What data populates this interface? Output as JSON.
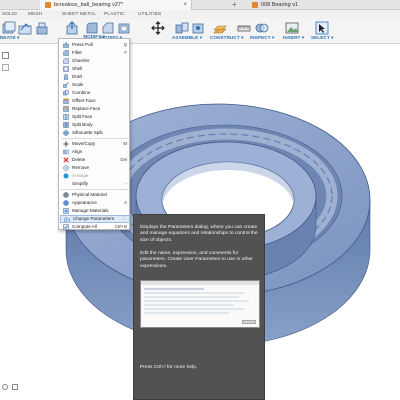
{
  "tabs": {
    "active": {
      "label": "bcrealess_ball_bearing v27*",
      "close": "×"
    },
    "add": "+",
    "second": {
      "label": "008 Bearing v1"
    }
  },
  "workspace_tabs": [
    "SOLID",
    "MESH",
    "SHEET METAL",
    "PLASTIC",
    "UTILITIES"
  ],
  "ribbon": {
    "groups": [
      "REATE ▾",
      "MODIFY ▾",
      "ASSEMBLE ▾",
      "CONSTRUCT ▾",
      "INSPECT ▾",
      "INSERT ▾",
      "SELECT ▾"
    ]
  },
  "modify_menu": {
    "header": "MODIFY ▾",
    "items": [
      {
        "label": "Press Pull",
        "shortcut": "Q",
        "icon": "press-pull-icon"
      },
      {
        "label": "Fillet",
        "shortcut": "F",
        "icon": "fillet-icon"
      },
      {
        "label": "Chamfer",
        "shortcut": "",
        "icon": "chamfer-icon"
      },
      {
        "label": "Shell",
        "shortcut": "",
        "icon": "shell-icon"
      },
      {
        "label": "Draft",
        "shortcut": "",
        "icon": "draft-icon"
      },
      {
        "label": "Scale",
        "shortcut": "",
        "icon": "scale-icon"
      },
      {
        "label": "Combine",
        "shortcut": "",
        "icon": "combine-icon"
      },
      {
        "label": "Offset Face",
        "shortcut": "",
        "icon": "offset-face-icon"
      },
      {
        "label": "Replace Face",
        "shortcut": "",
        "icon": "replace-face-icon"
      },
      {
        "label": "Split Face",
        "shortcut": "",
        "icon": "split-face-icon"
      },
      {
        "label": "Split Body",
        "shortcut": "",
        "icon": "split-body-icon"
      },
      {
        "label": "Silhouette Split",
        "shortcut": "",
        "icon": "silhouette-split-icon"
      },
      {
        "label": "Move/Copy",
        "shortcut": "M",
        "icon": "move-copy-icon"
      },
      {
        "label": "Align",
        "shortcut": "",
        "icon": "align-icon"
      },
      {
        "label": "Delete",
        "shortcut": "Del",
        "icon": "delete-icon"
      },
      {
        "label": "Remove",
        "shortcut": "",
        "icon": "remove-icon"
      },
      {
        "label": "Arrange",
        "shortcut": "",
        "icon": "arrange-icon"
      },
      {
        "label": "Simplify",
        "shortcut": "›",
        "icon": "simplify-icon"
      },
      {
        "label": "Physical Material",
        "shortcut": "",
        "icon": "physical-material-icon"
      },
      {
        "label": "Appearance",
        "shortcut": "A",
        "icon": "appearance-icon"
      },
      {
        "label": "Manage Materials",
        "shortcut": "",
        "icon": "manage-materials-icon"
      },
      {
        "label": "Change Parameters",
        "shortcut": "⋮",
        "icon": "change-parameters-icon"
      },
      {
        "label": "Compute All",
        "shortcut": "Ctrl+B",
        "icon": "compute-all-icon"
      }
    ]
  },
  "tooltip": {
    "description": "Displays the Parameters dialog, where you can create and manage equations and relationships to control the size of objects.",
    "detail": "Edit the name, expression, and comments for parameters. Create User Parameters to use in other expressions.",
    "help": "Press Ctrl+/ for more help."
  },
  "colors": {
    "accent": "#2b6fb4",
    "bearing_face": "#7c96c4",
    "bearing_dark": "#4f6a9a",
    "tooltip_bg": "#525252",
    "highlight": "#dfe9f5"
  }
}
